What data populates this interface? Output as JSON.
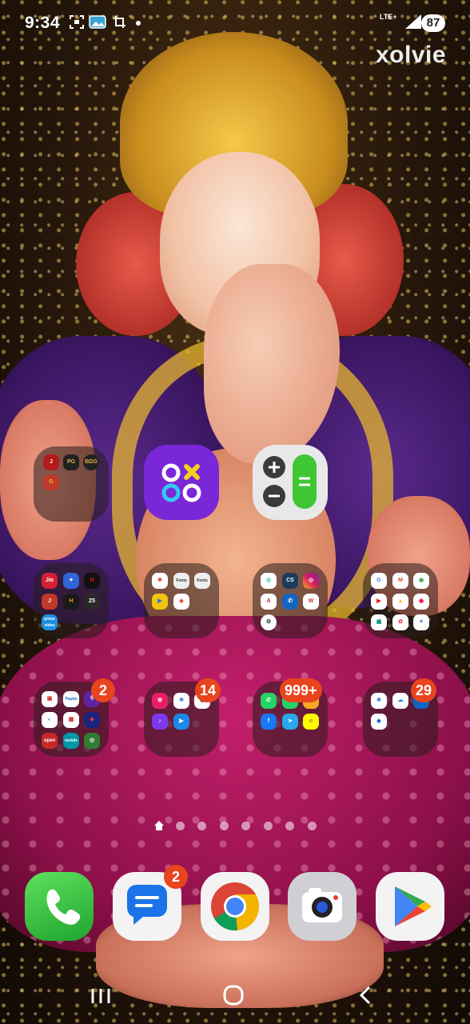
{
  "status_bar": {
    "time": "9:34",
    "network": "LTE+",
    "battery": "87"
  },
  "watermark": "xolvie",
  "folders": [
    {
      "id": "games",
      "apps": [
        "Jio",
        "PUBG",
        "BDG",
        "Game"
      ],
      "badge": ""
    },
    {
      "id": "entertainment",
      "apps": [
        "Jio",
        "Jio",
        "Netflix",
        "Jio",
        "Hotstar",
        "Zee5",
        "prime video"
      ],
      "badge": ""
    },
    {
      "id": "tools",
      "apps": [
        "Photos",
        "Fonts",
        "Fonts",
        "Meet",
        "Drive",
        "Maps"
      ],
      "badge": ""
    },
    {
      "id": "utilities",
      "apps": [
        "Camera",
        "CS",
        "Instagram",
        "Adobe",
        "Phone",
        "WPS",
        "Settings"
      ],
      "badge": ""
    },
    {
      "id": "google",
      "apps": [
        "Google",
        "Gmail",
        "Maps",
        "YouTube",
        "Drive",
        "YT Music",
        "Meet",
        "Photos",
        "Gemini"
      ],
      "badge": ""
    },
    {
      "id": "finance",
      "apps": [
        "Bank",
        "Paytm",
        "PhonePe",
        "Pay",
        "Scan",
        "Wallet",
        "open",
        "mobile",
        "Bank"
      ],
      "badge": "2"
    },
    {
      "id": "media",
      "apps": [
        "Photos",
        "Gallery",
        "Camera",
        "TikTok",
        "Play"
      ],
      "badge": "14"
    },
    {
      "id": "social",
      "apps": [
        "WhatsApp",
        "WhatsApp",
        "Snap",
        "Facebook",
        "Telegram",
        "Snapchat"
      ],
      "badge": "999+"
    },
    {
      "id": "cloud",
      "apps": [
        "Photos",
        "Cloud",
        "Files",
        "LinkedIn"
      ],
      "badge": "29"
    }
  ],
  "home_apps": [
    {
      "id": "mathsolver",
      "label": ""
    },
    {
      "id": "calculator",
      "label": ""
    }
  ],
  "dock": [
    {
      "id": "phone",
      "badge": ""
    },
    {
      "id": "messages",
      "badge": "2"
    },
    {
      "id": "chrome",
      "badge": ""
    },
    {
      "id": "camera",
      "badge": ""
    },
    {
      "id": "playstore",
      "badge": ""
    }
  ],
  "page_indicator": {
    "pages": 8,
    "current": 1
  },
  "colors": {
    "badge": "#e8441e",
    "folder_bg": "rgba(40,30,28,0.55)"
  }
}
